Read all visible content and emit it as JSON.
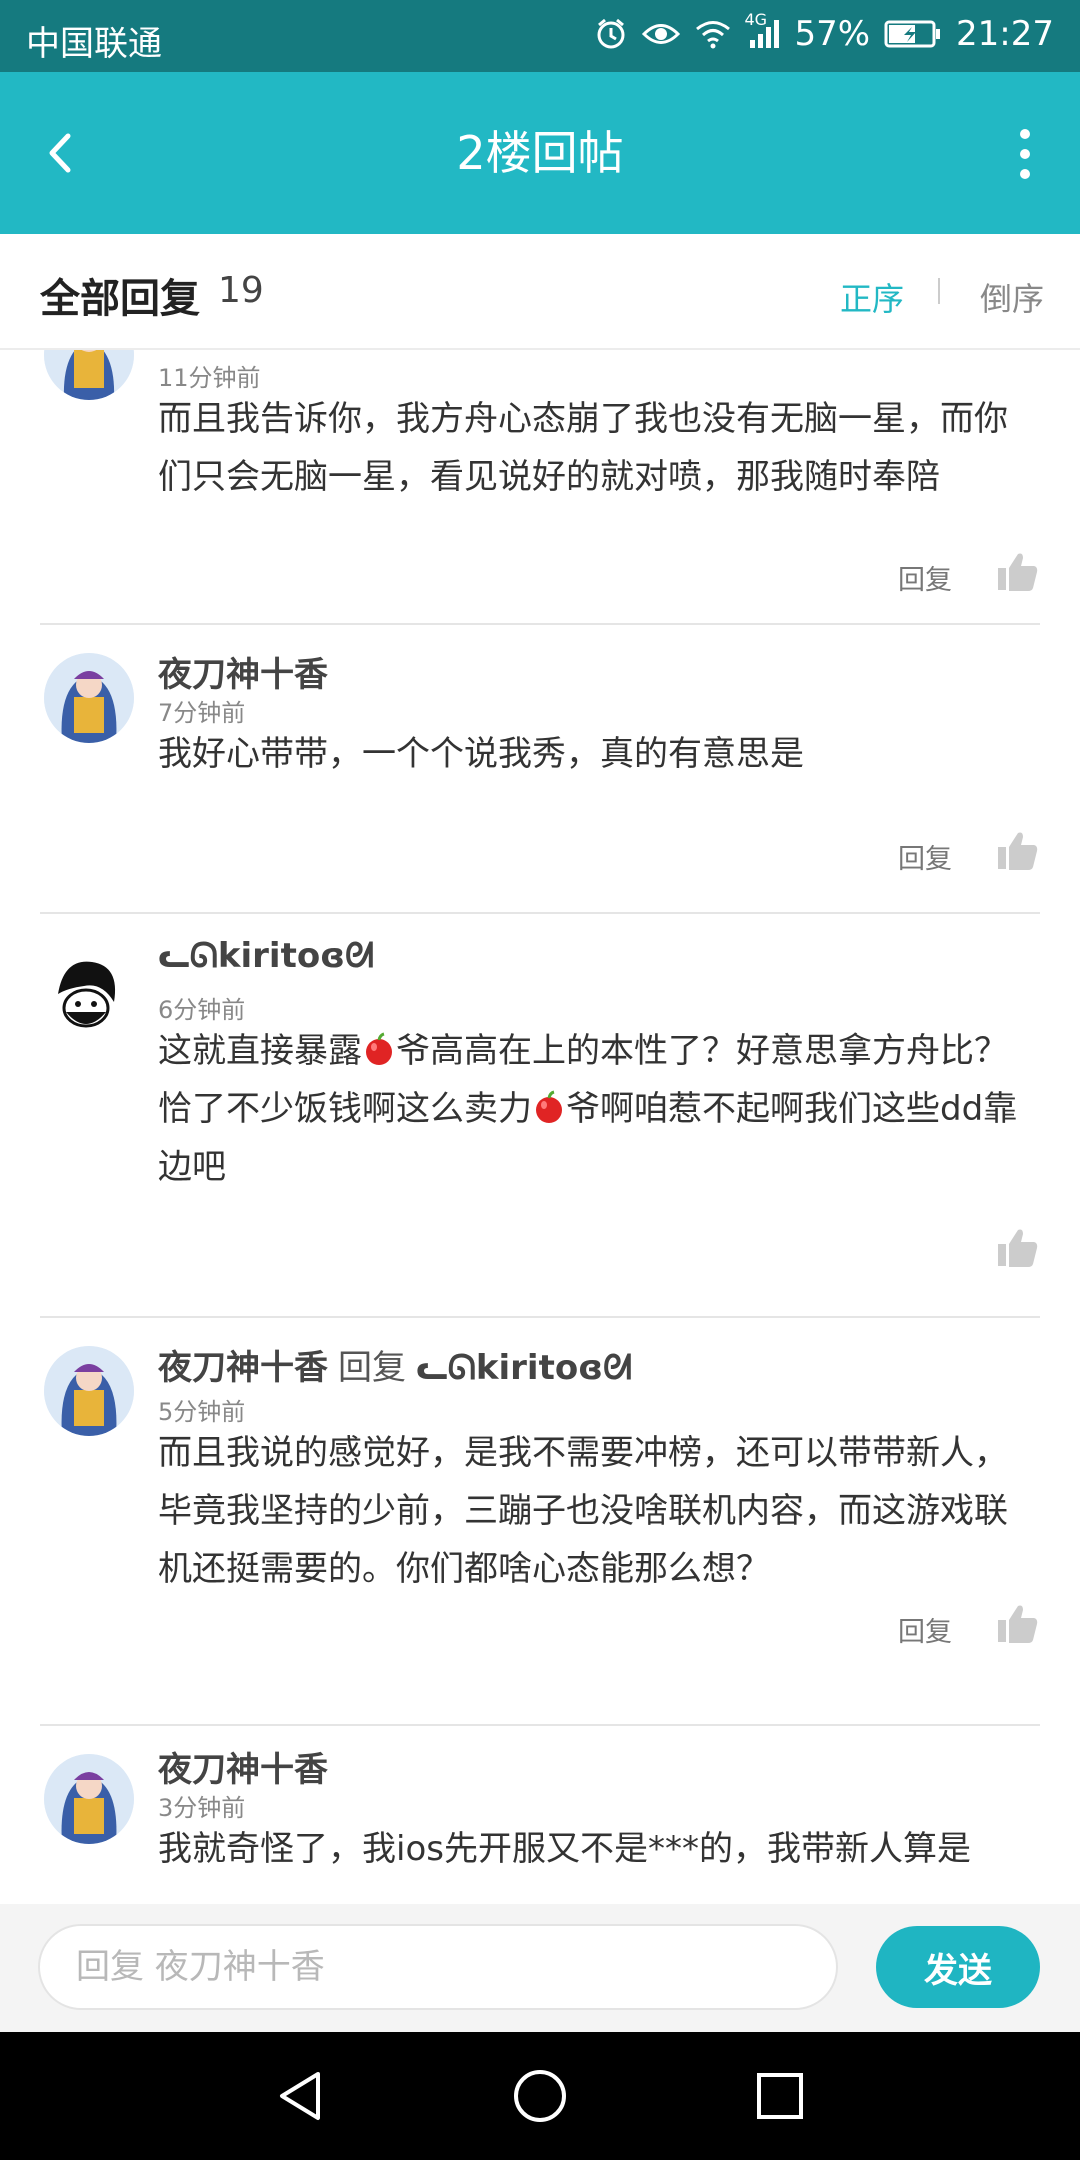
{
  "status_bar": {
    "carrier": "中国联通",
    "network": "4G",
    "battery": "57%",
    "time": "21:27"
  },
  "header": {
    "title": "2楼回帖",
    "back_icon": "chevron-left-icon",
    "more_icon": "more-vertical-icon"
  },
  "replies_bar": {
    "title": "全部回复",
    "count": "19",
    "sort_asc": "正序",
    "sort_desc": "倒序"
  },
  "comments": [
    {
      "time": "11分钟前",
      "body": "而且我告诉你，我方舟心态崩了我也没有无脑一星，而你们只会无脑一星，看见说好的就对喷，那我随时奉陪",
      "reply_label": "回复"
    },
    {
      "name": "夜刀神十香",
      "time": "7分钟前",
      "body": "我好心带带，一个个说我秀，真的有意思是",
      "reply_label": "回复"
    },
    {
      "name": "ᓚᘏkiritoɞᘛ",
      "time": "6分钟前",
      "body_parts": [
        "这就直接暴露",
        "爷高高在上的本性了？好意思拿方舟比？恰了不少饭钱啊这么卖力",
        "爷啊咱惹不起啊我们这些dd靠边吧"
      ]
    },
    {
      "name": "夜刀神十香",
      "reply_word": "回复",
      "reply_to": "ᓚᘏkiritoɞᘛ",
      "time": "5分钟前",
      "body": "而且我说的感觉好，是我不需要冲榜，还可以带带新人，毕竟我坚持的少前，三蹦子也没啥联机内容，而这游戏联机还挺需要的。你们都啥心态能那么想？",
      "reply_label": "回复"
    },
    {
      "name": "夜刀神十香",
      "time": "3分钟前",
      "body": "我就奇怪了，我ios先开服又不是***的，我带新人算是"
    }
  ],
  "input": {
    "placeholder": "回复 夜刀神十香",
    "send_label": "发送"
  },
  "colors": {
    "status_bar": "#157a7f",
    "header": "#22b8c4",
    "accent": "#22b8c4",
    "send_button": "#1fb5c2"
  }
}
